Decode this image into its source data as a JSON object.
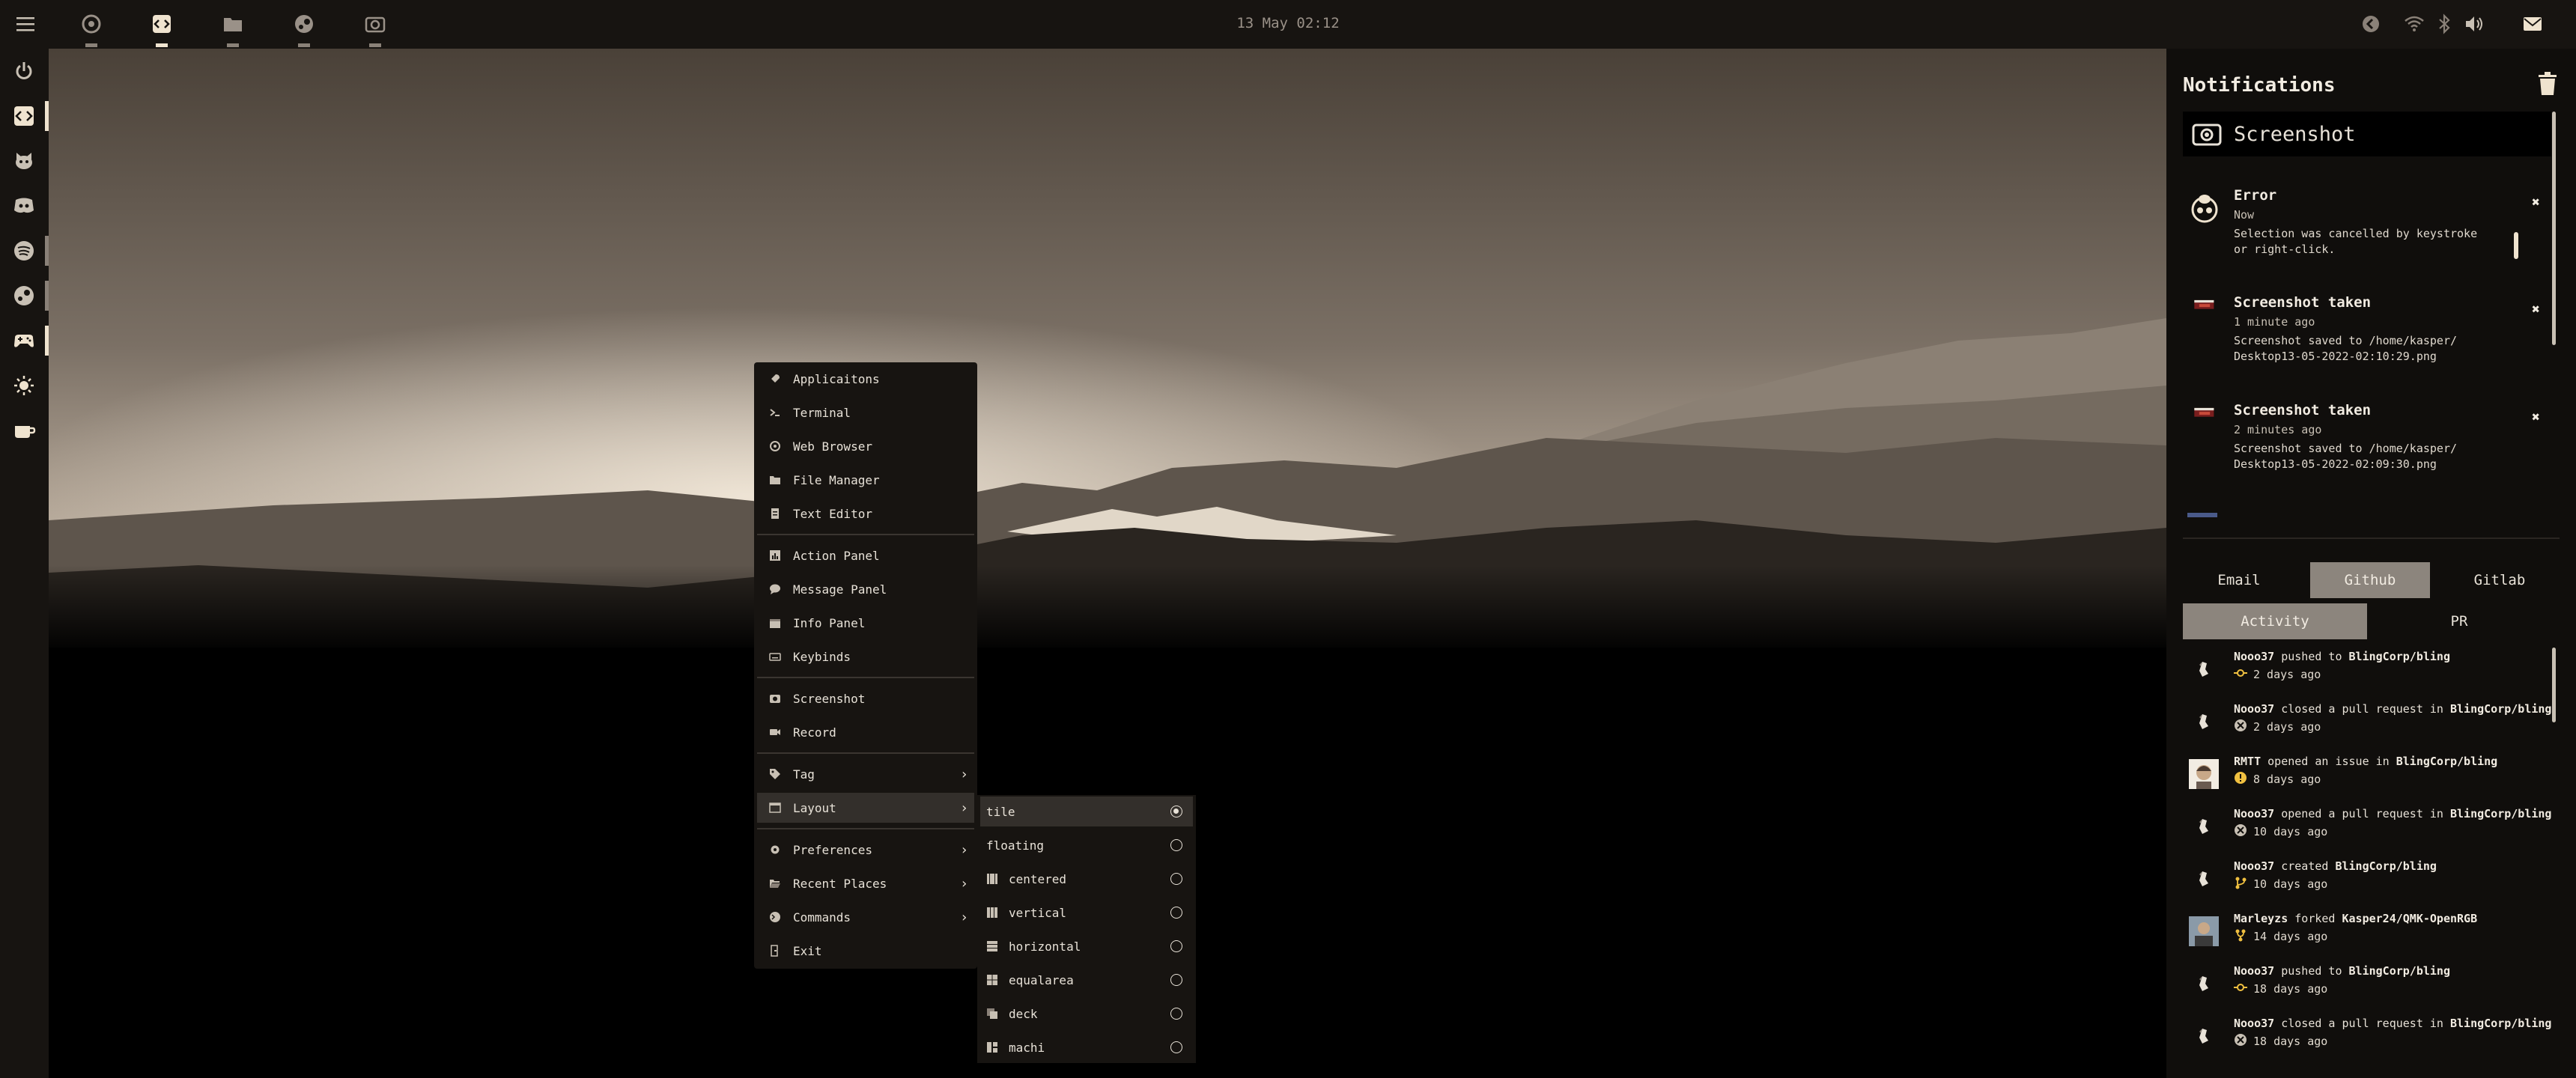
{
  "topbar": {
    "clock": "13 May 02:12",
    "workspaces": [
      {
        "icon": "chrome-icon",
        "active": false
      },
      {
        "icon": "code-icon",
        "active": true
      },
      {
        "icon": "folder-icon",
        "active": false
      },
      {
        "icon": "steam-icon",
        "active": false
      },
      {
        "icon": "camera-icon",
        "active": false
      }
    ],
    "tray_icons": [
      "back-icon",
      "wifi-icon",
      "bluetooth-icon",
      "volume-icon",
      "mail-icon"
    ]
  },
  "dock": {
    "items": [
      {
        "icon": "power-icon"
      },
      {
        "icon": "code-icon",
        "running": true
      },
      {
        "icon": "github-icon"
      },
      {
        "icon": "discord-icon"
      },
      {
        "icon": "spotify-icon",
        "running": true
      },
      {
        "icon": "steam-icon",
        "running": true
      },
      {
        "icon": "gamepad-icon",
        "running": true,
        "active": true
      },
      {
        "icon": "brightness-icon"
      },
      {
        "icon": "coffee-icon"
      }
    ]
  },
  "menu": {
    "items": [
      {
        "label": "Applicaitons",
        "icon": "rocket-icon"
      },
      {
        "label": "Terminal",
        "icon": "terminal-icon"
      },
      {
        "label": "Web Browser",
        "icon": "chrome-icon"
      },
      {
        "label": "File Manager",
        "icon": "folder-icon"
      },
      {
        "label": "Text Editor",
        "icon": "file-icon"
      },
      {
        "label": "Action Panel",
        "icon": "chart-icon"
      },
      {
        "label": "Message Panel",
        "icon": "message-icon"
      },
      {
        "label": "Info Panel",
        "icon": "calendar-icon"
      },
      {
        "label": "Keybinds",
        "icon": "keyboard-icon"
      },
      {
        "label": "Screenshot",
        "icon": "camera-icon"
      },
      {
        "label": "Record",
        "icon": "video-icon"
      },
      {
        "label": "Tag",
        "icon": "tag-icon"
      },
      {
        "label": "Layout",
        "icon": "layout-icon"
      },
      {
        "label": "Preferences",
        "icon": "gear-icon"
      },
      {
        "label": "Recent Places",
        "icon": "folder-open-icon"
      },
      {
        "label": "Commands",
        "icon": "terminal-box-icon"
      },
      {
        "label": "Exit",
        "icon": "exit-icon"
      }
    ]
  },
  "layout_submenu": {
    "items": [
      {
        "label": "tile",
        "selected": true
      },
      {
        "label": "floating",
        "selected": false
      },
      {
        "label": "centered",
        "selected": false
      },
      {
        "label": "vertical",
        "selected": false
      },
      {
        "label": "horizontal",
        "selected": false
      },
      {
        "label": "equalarea",
        "selected": false
      },
      {
        "label": "deck",
        "selected": false
      },
      {
        "label": "machi",
        "selected": false
      }
    ]
  },
  "notifications": {
    "title": "Notifications",
    "source_app": "Screenshot",
    "items": [
      {
        "title": "Error",
        "time": "Now",
        "body": "Selection was cancelled by keystroke or right-click.",
        "icon": "error-icon"
      },
      {
        "title": "Screenshot taken",
        "time": "1 minute ago",
        "body": "Screenshot saved to /home/kasper/\nDesktop13-05-2022-02:10:29.png",
        "icon": "screenshot-thumb-icon"
      },
      {
        "title": "Screenshot taken",
        "time": "2 minutes ago",
        "body": "Screenshot saved to /home/kasper/\nDesktop13-05-2022-02:09:30.png",
        "icon": "screenshot-thumb-icon"
      }
    ]
  },
  "panel_tabs": {
    "items": [
      "Email",
      "Github",
      "Gitlab"
    ],
    "active": "Github"
  },
  "github_tabs": {
    "items": [
      "Activity",
      "PR"
    ],
    "active": "Activity"
  },
  "activity": [
    {
      "user": "Nooo37",
      "action": "pushed to",
      "repo": "BlingCorp/bling",
      "time": "2 days ago",
      "icon": "commit-icon"
    },
    {
      "user": "Nooo37",
      "action": "closed a pull request in",
      "repo": "BlingCorp/bling",
      "time": "2 days ago",
      "icon": "pr-closed-icon"
    },
    {
      "user": "RMTT",
      "action": "opened an issue in",
      "repo": "BlingCorp/bling",
      "time": "8 days ago",
      "icon": "issue-icon"
    },
    {
      "user": "Nooo37",
      "action": "opened a pull request in",
      "repo": "BlingCorp/bling",
      "time": "10 days ago",
      "icon": "pr-closed-icon"
    },
    {
      "user": "Nooo37",
      "action": "created",
      "repo": "BlingCorp/bling",
      "time": "10 days ago",
      "icon": "branch-icon"
    },
    {
      "user": "Marleyzs",
      "action": "forked",
      "repo": "Kasper24/QMK-OpenRGB",
      "time": "14 days ago",
      "icon": "fork-icon"
    },
    {
      "user": "Nooo37",
      "action": "pushed to",
      "repo": "BlingCorp/bling",
      "time": "18 days ago",
      "icon": "commit-icon"
    },
    {
      "user": "Nooo37",
      "action": "closed a pull request in",
      "repo": "BlingCorp/bling",
      "time": "18 days ago",
      "icon": "pr-closed-icon"
    }
  ]
}
